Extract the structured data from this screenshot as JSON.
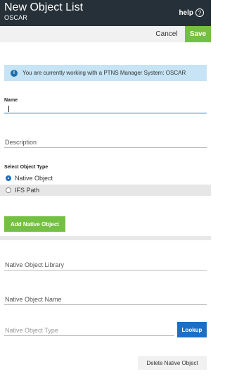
{
  "header": {
    "title": "New Object List",
    "subtitle": "OSCAR",
    "help_label": "help",
    "help_icon": "?"
  },
  "actions": {
    "cancel": "Cancel",
    "save": "Save"
  },
  "info_banner": {
    "icon": "i",
    "text": "You are currently working with a PTNS Manager System: OSCAR"
  },
  "form": {
    "name_label": "Name",
    "name_value": "",
    "description_label": "Description",
    "object_type_label": "Select Object Type",
    "object_type_options": [
      {
        "label": "Native Object",
        "selected": true
      },
      {
        "label": "IFS Path",
        "selected": false
      }
    ],
    "add_button": "Add Native Object"
  },
  "native_object": {
    "library_label": "Native Object Library",
    "name_label": "Native Object Name",
    "type_label": "Native Object Type",
    "lookup_button": "Lookup",
    "delete_button": "Delete Native Object"
  },
  "colors": {
    "header_bg": "#263038",
    "save_green": "#74c043",
    "lookup_blue": "#1e6fc4",
    "info_bg": "#c6e4f5"
  }
}
